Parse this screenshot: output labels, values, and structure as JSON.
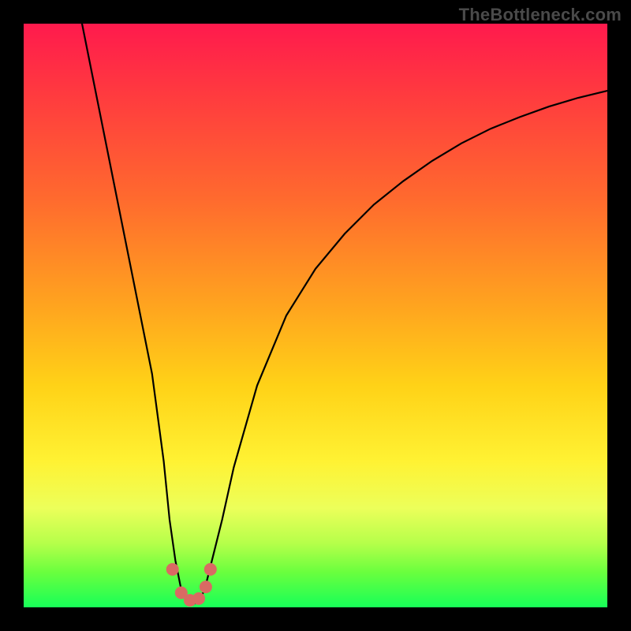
{
  "watermark": "TheBottleneck.com",
  "chart_data": {
    "type": "line",
    "title": "",
    "xlabel": "",
    "ylabel": "",
    "xlim": [
      0,
      100
    ],
    "ylim": [
      0,
      100
    ],
    "series": [
      {
        "name": "curve",
        "x": [
          10,
          12,
          14,
          16,
          18,
          20,
          22,
          24,
          25,
          26,
          27,
          28,
          29,
          30,
          31,
          32,
          34,
          36,
          40,
          45,
          50,
          55,
          60,
          65,
          70,
          75,
          80,
          85,
          90,
          95,
          100
        ],
        "y": [
          100,
          90,
          80,
          70,
          60,
          50,
          40,
          25,
          15,
          8,
          3,
          1,
          0.5,
          1,
          3,
          7,
          15,
          24,
          38,
          50,
          58,
          64,
          69,
          73,
          76.5,
          79.5,
          82,
          84,
          85.8,
          87.3,
          88.5
        ]
      }
    ],
    "markers": {
      "name": "bottom-cluster",
      "color": "#d96a63",
      "points": [
        {
          "x": 25.5,
          "y": 6.5
        },
        {
          "x": 27.0,
          "y": 2.5
        },
        {
          "x": 28.5,
          "y": 1.2
        },
        {
          "x": 30.0,
          "y": 1.5
        },
        {
          "x": 31.2,
          "y": 3.5
        },
        {
          "x": 32.0,
          "y": 6.5
        }
      ]
    },
    "gradient_stops": [
      {
        "pos": 0,
        "color": "#ff1a4d"
      },
      {
        "pos": 30,
        "color": "#ff6a2e"
      },
      {
        "pos": 62,
        "color": "#ffd217"
      },
      {
        "pos": 83,
        "color": "#ecff5a"
      },
      {
        "pos": 100,
        "color": "#17ff58"
      }
    ]
  }
}
